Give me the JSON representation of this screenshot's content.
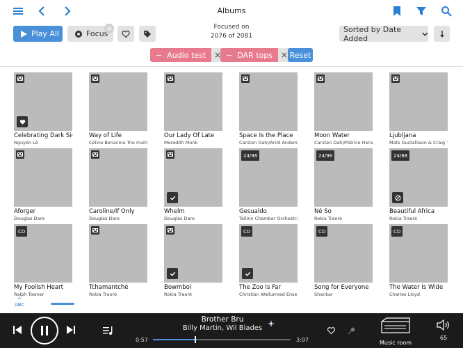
{
  "header": {
    "title": "Albums"
  },
  "toolbar": {
    "play_all": "Play All",
    "focus": "Focus",
    "focused_line1": "Focused on",
    "focused_line2": "2076 of 2081",
    "sort": "Sorted by Date Added"
  },
  "filters": [
    {
      "label": "Audio test"
    },
    {
      "label": "DAR tops"
    }
  ],
  "reset": "Reset",
  "albums": [
    {
      "title": "Celebrating Dark Side",
      "artist": "Nguyên Lê",
      "badge": "icon",
      "mark": "heart"
    },
    {
      "title": "Way of Life",
      "artist": "Céline Bonacina Trio Invitin",
      "badge": "icon",
      "mark": ""
    },
    {
      "title": "Our Lady Of Late",
      "artist": "Meredith Monk",
      "badge": "icon",
      "mark": ""
    },
    {
      "title": "Space Is the Place",
      "artist": "Carsten Dahl/Arild Anders",
      "badge": "icon",
      "mark": ""
    },
    {
      "title": "Moon Water",
      "artist": "Carsten Dahl/Patrice Hera",
      "badge": "icon",
      "mark": ""
    },
    {
      "title": "Ljubljana",
      "artist": "Mats Gustafsson & Craig T",
      "badge": "icon",
      "mark": ""
    },
    {
      "title": "Aforger",
      "artist": "Douglas Dare",
      "badge": "icon",
      "mark": ""
    },
    {
      "title": "Caroline/If Only",
      "artist": "Douglas Dare",
      "badge": "icon",
      "mark": ""
    },
    {
      "title": "Whelm",
      "artist": "Douglas Dare",
      "badge": "icon",
      "mark": "check"
    },
    {
      "title": "Gesualdo",
      "artist": "Tallinn Chamber Orchestra",
      "badge": "24/96",
      "mark": ""
    },
    {
      "title": "Né So",
      "artist": "Rokia Traoré",
      "badge": "24/96",
      "mark": ""
    },
    {
      "title": "Beautiful Africa",
      "artist": "Rokia Traoré",
      "badge": "24/88",
      "mark": "ban"
    },
    {
      "title": "My Foolish Heart",
      "artist": "Ralph Towner",
      "badge": "CD",
      "mark": ""
    },
    {
      "title": "Tchamantché",
      "artist": "Rokia Traoré",
      "badge": "icon",
      "mark": ""
    },
    {
      "title": "Bowmboi",
      "artist": "Rokia Traoré",
      "badge": "icon",
      "mark": "check"
    },
    {
      "title": "The Zoo Is Far",
      "artist": "Christian Wallumrød Enser",
      "badge": "CD",
      "mark": "check"
    },
    {
      "title": "Song for Everyone",
      "artist": "Shankar",
      "badge": "CD",
      "mark": ""
    },
    {
      "title": "The Water Is Wide",
      "artist": "Charles Lloyd",
      "badge": "CD",
      "mark": ""
    }
  ],
  "alpha_jump": "ABC",
  "player": {
    "song": "Brother Bru",
    "artists": "Billy Martin, Wil Blades",
    "elapsed": "0:57",
    "duration": "3:07",
    "progress": 0.305,
    "zone": "Music room",
    "volume": "65"
  },
  "colors": {
    "accent": "#4a90d9",
    "filter_chip": "#e87a8d",
    "player_bg": "#1b1b1b"
  }
}
